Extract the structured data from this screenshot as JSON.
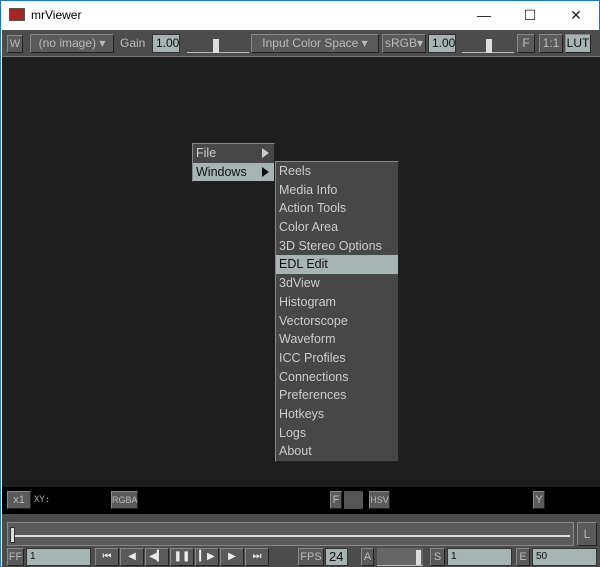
{
  "window": {
    "title": "mrViewer",
    "controls": {
      "minimize": "—",
      "maximize": "☐",
      "close": "✕"
    }
  },
  "toolbar": {
    "w": "W",
    "image_select": "(no image)",
    "gain_label": "Gain",
    "gain_value": "1.00",
    "input_color_space": "Input Color Space",
    "output_space": "sRGB",
    "gamma_value": "1.00",
    "f": "F",
    "ratio": "1:1",
    "lut": "LUT"
  },
  "menu": {
    "items": [
      {
        "label": "File",
        "submenu": true
      },
      {
        "label": "Windows",
        "submenu": true,
        "selected": true
      }
    ]
  },
  "submenu": {
    "items": [
      "Reels",
      "Media Info",
      "Action Tools",
      "Color Area",
      "3D Stereo Options",
      "EDL Edit",
      "3dView",
      "Histogram",
      "Vectorscope",
      "Waveform",
      "ICC Profiles",
      "Connections",
      "Preferences",
      "Hotkeys",
      "Logs",
      "About"
    ],
    "selected": "EDL Edit"
  },
  "infobar": {
    "zoom": "x1",
    "xy_label": "XY:",
    "rgba": "RGBA",
    "f": "F",
    "hsv": "HSV",
    "y": "Y"
  },
  "timeline": {
    "loop": "L",
    "frame_label": "FF",
    "frame": "1",
    "fps_label": "FPS",
    "fps": "24",
    "audio": "A",
    "start_label": "S",
    "start": "1",
    "end_label": "E",
    "end": "50"
  },
  "transport": [
    "first-frame",
    "step-back",
    "play-backwards",
    "pause",
    "play-forwards",
    "step-forward",
    "last-frame"
  ]
}
